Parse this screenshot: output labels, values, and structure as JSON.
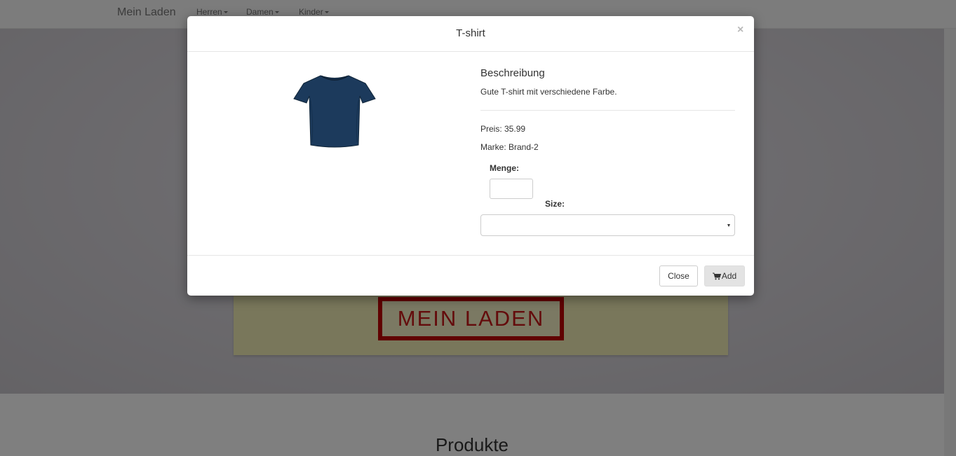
{
  "navbar": {
    "brand": "Mein Laden",
    "items": [
      {
        "label": "Herren"
      },
      {
        "label": "Damen"
      },
      {
        "label": "Kinder"
      }
    ]
  },
  "hero": {
    "sign_text": "MEIN LADEN"
  },
  "main": {
    "section_title": "Produkte"
  },
  "modal": {
    "title": "T-shirt",
    "close_symbol": "×",
    "description_heading": "Beschreibung",
    "description": "Gute T-shirt mit verschiedene Farbe.",
    "price_text": "Preis: 35.99",
    "brand_text": "Marke: Brand-2",
    "quantity_label": "Menge:",
    "quantity_value": "",
    "size_label": "Size:",
    "size_selected": "",
    "close_button": "Close",
    "add_button": "Add",
    "product_color": "#1c3a5c",
    "add_icon": "shopping-cart-icon"
  }
}
